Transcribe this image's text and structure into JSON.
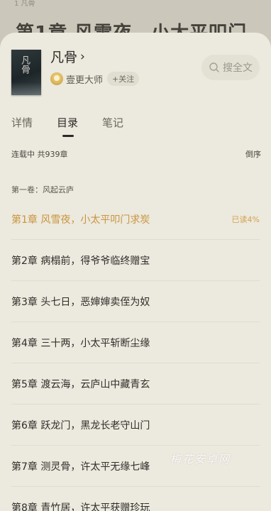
{
  "reader": {
    "top_info": "1 凡骨",
    "chapter_heading": "第1章 风雪夜，小太平叩门"
  },
  "book": {
    "cover_text": "凡骨",
    "title": "凡骨",
    "author": "壹更大师",
    "follow_label": "+关注",
    "search_label": "搜全文"
  },
  "tabs": [
    {
      "label": "详情"
    },
    {
      "label": "目录"
    },
    {
      "label": "笔记"
    }
  ],
  "status": {
    "text": "连载中 共939章",
    "sort_label": "倒序"
  },
  "volume": "第一卷：风起云庐",
  "chapters": [
    {
      "title": "第1章 风雪夜，小太平叩门求炭",
      "tag": "已读4%"
    },
    {
      "title": "第2章 病榻前，得爷爷临终赠宝"
    },
    {
      "title": "第3章 头七日，恶婶婶卖侄为奴"
    },
    {
      "title": "第4章 三十两，小太平斩断尘缘"
    },
    {
      "title": "第5章 渡云海，云庐山中藏青玄"
    },
    {
      "title": "第6章 跃龙门，黑龙长老守山门"
    },
    {
      "title": "第7章 测灵骨，许太平无缘七峰"
    },
    {
      "title": "第8章 青竹居，许太平获赠珍玩"
    }
  ],
  "watermark": "梅花安卓网",
  "colors": {
    "accent": "#c9953f",
    "sheet_bg": "#ece9de",
    "text": "#2f2e2a"
  }
}
